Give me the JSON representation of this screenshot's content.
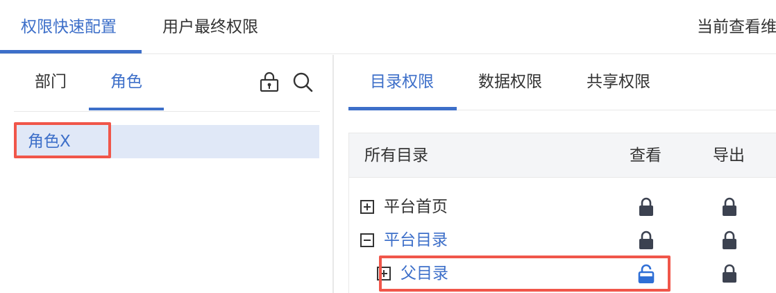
{
  "top_tabs": {
    "quick_config": "权限快速配置",
    "final_perm": "用户最终权限"
  },
  "viewing_label": "当前查看维",
  "left": {
    "tabs": {
      "dept": "部门",
      "role": "角色"
    },
    "icons": [
      "lock-settings-icon",
      "search-icon"
    ],
    "roles": [
      "角色X"
    ]
  },
  "right": {
    "tabs": {
      "catalog": "目录权限",
      "data": "数据权限",
      "share": "共享权限"
    },
    "table": {
      "headers": {
        "all": "所有目录",
        "view": "查看",
        "export": "导出"
      },
      "rows": [
        {
          "label": "平台首页",
          "expander": "plus",
          "view": "locked",
          "export": "locked"
        },
        {
          "label": "平台目录",
          "expander": "minus",
          "view": "locked",
          "export": "locked"
        },
        {
          "label": "父目录",
          "expander": "plus",
          "view": "unlocked",
          "export": "locked"
        }
      ]
    }
  },
  "colors": {
    "accent": "#3d6fc9",
    "highlight": "#f0564a",
    "lock_dark": "#3c4250",
    "selected_bg": "#e0e8f7"
  }
}
